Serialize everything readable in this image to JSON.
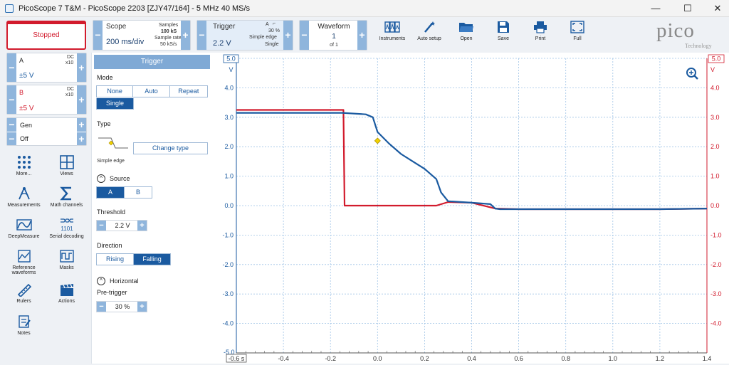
{
  "window": {
    "title": "PicoScope 7 T&M  - PicoScope 2203 [ZJY47/164] - 5 MHz 40 MS/s",
    "minimize": "—",
    "maximize": "☐",
    "close": "✕"
  },
  "run": {
    "status": "Stopped"
  },
  "scope": {
    "label": "Scope",
    "timebase": "200 ms/div",
    "samples_label": "Samples",
    "samples": "100 kS",
    "rate_label": "Sample rate",
    "rate": "50 kS/s"
  },
  "trigger_ctrl": {
    "label": "Trigger",
    "level": "2.2 V",
    "channel": "A",
    "pretrigger": "30 %",
    "type": "Simple edge",
    "mode": "Single"
  },
  "waveform": {
    "label": "Waveform",
    "current": "1",
    "total": "of 1"
  },
  "toolbar": {
    "instruments": "Instruments",
    "auto_setup": "Auto setup",
    "open": "Open",
    "save": "Save",
    "print": "Print",
    "full": "Full"
  },
  "logo": {
    "text": "pico",
    "sub": "Technology"
  },
  "channels": [
    {
      "name": "A",
      "coupling": "DC",
      "probe": "x10",
      "range": "±5 V",
      "color": "#1a5aa0"
    },
    {
      "name": "B",
      "coupling": "DC",
      "probe": "x10",
      "range": "±5 V",
      "color": "#d21b2d"
    }
  ],
  "gen": {
    "label": "Gen",
    "state": "Off"
  },
  "tools": [
    "More...",
    "Views",
    "Measurements",
    "Math channels",
    "DeepMeasure",
    "Serial decoding",
    "Reference waveforms",
    "Masks",
    "Rulers",
    "Actions",
    "Notes"
  ],
  "trigger_panel": {
    "header": "Trigger",
    "mode_label": "Mode",
    "modes": [
      "None",
      "Auto",
      "Repeat",
      "Single"
    ],
    "selected_mode": "Single",
    "type_label": "Type",
    "type_name": "Simple edge",
    "change_type": "Change type",
    "source_label": "Source",
    "sources": [
      "A",
      "B"
    ],
    "selected_source": "A",
    "threshold_label": "Threshold",
    "threshold": "2.2 V",
    "direction_label": "Direction",
    "directions": [
      "Rising",
      "Falling"
    ],
    "selected_direction": "Falling",
    "horizontal_label": "Horizontal",
    "pretrigger_label": "Pre-trigger",
    "pretrigger": "30 %"
  },
  "chart_data": {
    "type": "line",
    "x_ticks": [
      "-0.6 s",
      "-0.4",
      "-0.2",
      "0.0",
      "0.2",
      "0.4",
      "0.6",
      "0.8",
      "1.0",
      "1.2",
      "1.4"
    ],
    "y_ticks": [
      "4.0",
      "3.0",
      "2.0",
      "1.0",
      "0.0",
      "-1.0",
      "-2.0",
      "-3.0",
      "-4.0"
    ],
    "xlim": [
      -0.6,
      1.4
    ],
    "ylim": [
      -5,
      5
    ],
    "left_axis_top": "5.0",
    "left_axis_unit": "V",
    "right_axis_top": "5.0",
    "right_axis_unit": "V",
    "bottom_left_value": "-5.0",
    "grid": true,
    "series": [
      {
        "name": "A",
        "color": "#1a5aa0",
        "x": [
          -0.6,
          -0.15,
          -0.05,
          -0.02,
          0.0,
          0.05,
          0.1,
          0.15,
          0.2,
          0.25,
          0.27,
          0.3,
          0.4,
          0.48,
          0.5,
          0.52,
          0.6,
          0.8,
          1.0,
          1.2,
          1.4
        ],
        "y": [
          3.15,
          3.15,
          3.1,
          3.0,
          2.5,
          2.1,
          1.75,
          1.5,
          1.25,
          0.9,
          0.45,
          0.15,
          0.1,
          0.05,
          -0.1,
          -0.12,
          -0.12,
          -0.12,
          -0.12,
          -0.12,
          -0.1
        ]
      },
      {
        "name": "B",
        "color": "#d21b2d",
        "x": [
          -0.6,
          -0.15,
          -0.145,
          -0.14,
          0.0,
          0.2,
          0.25,
          0.3,
          0.4,
          0.5,
          0.6,
          0.8,
          1.0,
          1.2,
          1.4
        ],
        "y": [
          3.25,
          3.25,
          3.25,
          0.0,
          0.0,
          0.0,
          0.0,
          0.12,
          0.1,
          -0.1,
          -0.12,
          -0.12,
          -0.12,
          -0.12,
          -0.1
        ]
      }
    ],
    "trigger_marker": {
      "x": 0.0,
      "y": 2.2
    }
  }
}
